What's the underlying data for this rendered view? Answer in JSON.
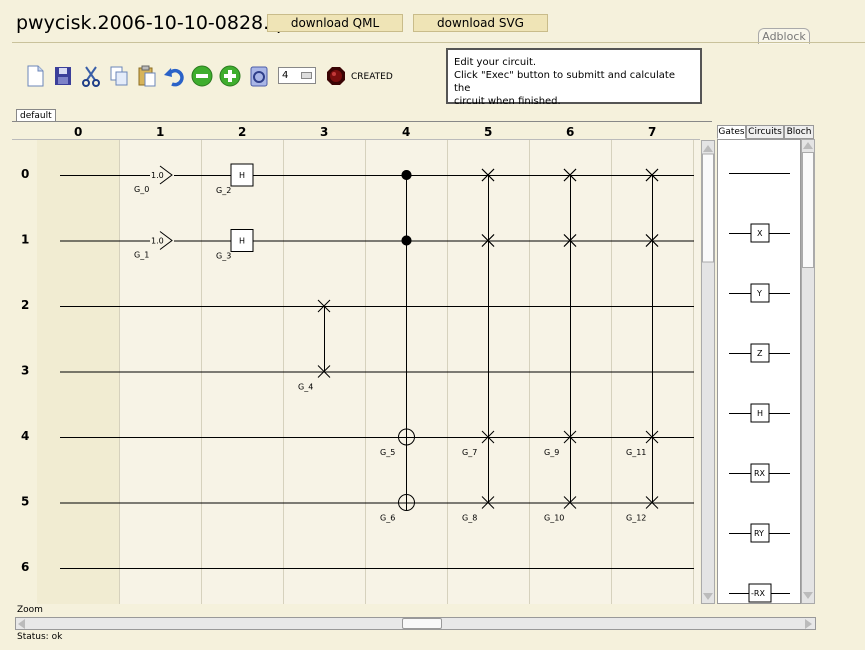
{
  "page": {
    "filename": "pwycisk.2006-10-10-0828.qml",
    "download_qml": "download QML",
    "download_svg": "download SVG",
    "adblock": "Adblock"
  },
  "toolbar": {
    "icons": [
      "new-file-icon",
      "save-icon",
      "cut-icon",
      "copy-icon",
      "paste-icon",
      "undo-icon",
      "remove-qubit-icon",
      "add-qubit-icon",
      "exec-icon"
    ],
    "qubit_count": "4",
    "status": "CREATED",
    "status_color": "#7a0e0e"
  },
  "hint": "Edit your circuit.\nClick \"Exec\" button to submitt and calculate the\ncircuit when finished.",
  "tabs": [
    "default"
  ],
  "circuit": {
    "columns": [
      "0",
      "1",
      "2",
      "3",
      "4",
      "5",
      "6",
      "7"
    ],
    "rows": [
      "0",
      "1",
      "2",
      "3",
      "4",
      "5",
      "6"
    ],
    "gates": [
      {
        "type": "input",
        "label": "1.0",
        "id": "G_0",
        "col": 1,
        "row": 0
      },
      {
        "type": "input",
        "label": "1.0",
        "id": "G_1",
        "col": 1,
        "row": 1
      },
      {
        "type": "box",
        "label": "H",
        "id": "G_2",
        "col": 2,
        "row": 0
      },
      {
        "type": "box",
        "label": "H",
        "id": "G_3",
        "col": 2,
        "row": 1
      },
      {
        "type": "swap",
        "id": "G_4",
        "col": 3,
        "rows": [
          2,
          3
        ]
      },
      {
        "type": "cnot",
        "id": "G_5",
        "col": 4,
        "controls": [
          0,
          1
        ],
        "target": 4
      },
      {
        "type": "cnot",
        "id": "G_6",
        "col": 4,
        "controls": [
          0,
          1
        ],
        "target": 5
      },
      {
        "type": "swap",
        "id": "G_7",
        "col": 5,
        "rows": [
          0,
          1,
          4
        ]
      },
      {
        "type": "swap",
        "id": "G_8",
        "col": 5,
        "rows": [
          0,
          1,
          5
        ]
      },
      {
        "type": "swap",
        "id": "G_9",
        "col": 6,
        "rows": [
          0,
          1,
          4
        ]
      },
      {
        "type": "swap",
        "id": "G_10",
        "col": 6,
        "rows": [
          0,
          1,
          5
        ]
      },
      {
        "type": "swap",
        "id": "G_11",
        "col": 7,
        "rows": [
          0,
          1,
          4
        ]
      },
      {
        "type": "swap",
        "id": "G_12",
        "col": 7,
        "rows": [
          0,
          1,
          5
        ]
      }
    ]
  },
  "palette": {
    "tabs": [
      "Gates",
      "Circuits",
      "Bloch"
    ],
    "active_tab": "Gates",
    "gates": [
      "",
      "X",
      "Y",
      "Z",
      "H",
      "RX",
      "RY",
      "-RX"
    ]
  },
  "zoom_label": "Zoom",
  "status_bar": "Status: ok"
}
